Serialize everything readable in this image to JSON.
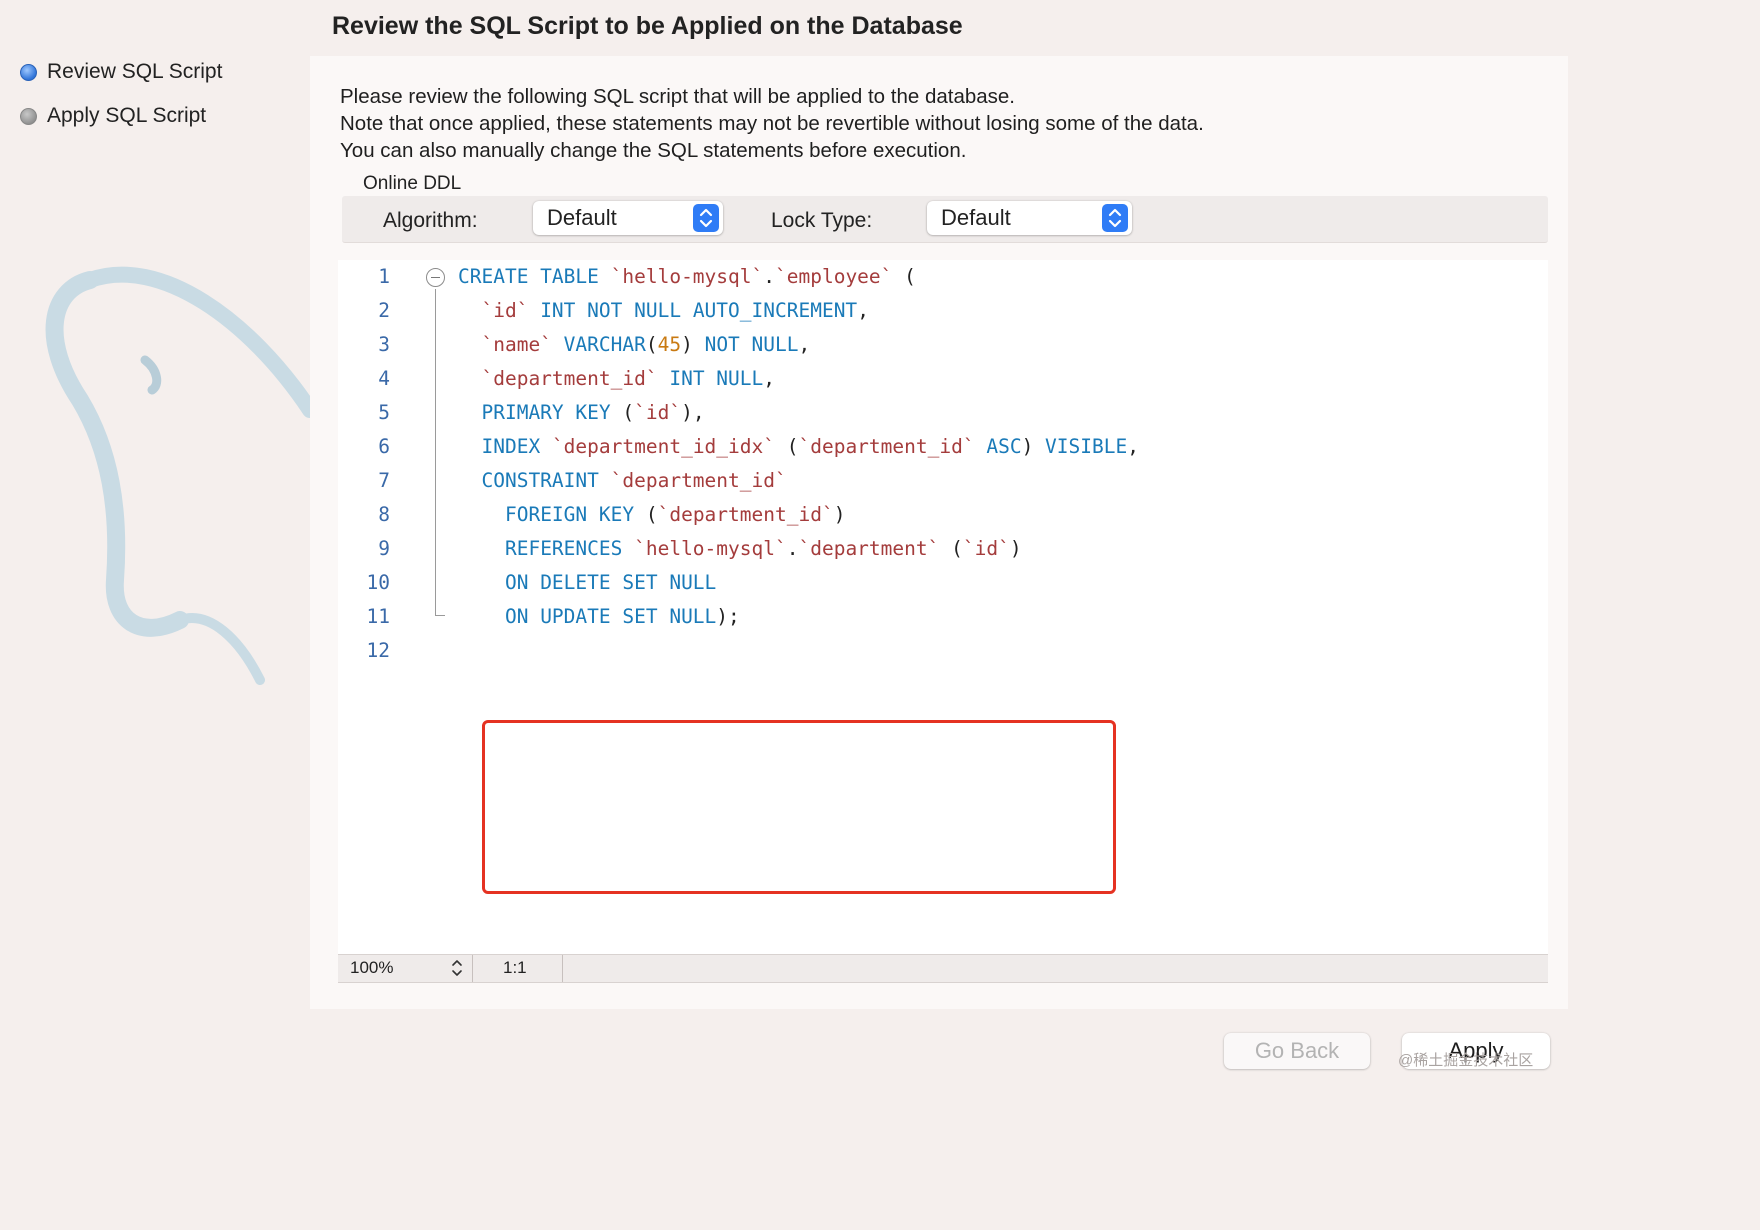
{
  "window": {
    "title": "Review the SQL Script to be Applied on the Database"
  },
  "steps": [
    {
      "label": "Review SQL Script",
      "state": "active"
    },
    {
      "label": "Apply SQL Script",
      "state": "pending"
    }
  ],
  "description": [
    "Please review the following SQL script that will be applied to the database.",
    "Note that once applied, these statements may not be revertible without losing some of the data.",
    "You can also manually change the SQL statements before execution."
  ],
  "online_ddl": {
    "label": "Online DDL",
    "algorithm_label": "Algorithm:",
    "algorithm_value": "Default",
    "lock_type_label": "Lock Type:",
    "lock_type_value": "Default"
  },
  "editor": {
    "lines": [
      [
        [
          "kw",
          "CREATE TABLE "
        ],
        [
          "str",
          "`hello-mysql`"
        ],
        [
          "plain",
          "."
        ],
        [
          "str",
          "`employee`"
        ],
        [
          "plain",
          " ("
        ]
      ],
      [
        [
          "plain",
          "  "
        ],
        [
          "str",
          "`id`"
        ],
        [
          "kw",
          " INT NOT NULL AUTO_INCREMENT"
        ],
        [
          "plain",
          ","
        ]
      ],
      [
        [
          "plain",
          "  "
        ],
        [
          "str",
          "`name`"
        ],
        [
          "kw",
          " VARCHAR"
        ],
        [
          "plain",
          "("
        ],
        [
          "num",
          "45"
        ],
        [
          "plain",
          ") "
        ],
        [
          "kw",
          "NOT NULL"
        ],
        [
          "plain",
          ","
        ]
      ],
      [
        [
          "plain",
          "  "
        ],
        [
          "str",
          "`department_id`"
        ],
        [
          "kw",
          " INT NULL"
        ],
        [
          "plain",
          ","
        ]
      ],
      [
        [
          "plain",
          "  "
        ],
        [
          "kw",
          "PRIMARY KEY"
        ],
        [
          "plain",
          " ("
        ],
        [
          "str",
          "`id`"
        ],
        [
          "plain",
          "),"
        ]
      ],
      [
        [
          "plain",
          "  "
        ],
        [
          "kw",
          "INDEX "
        ],
        [
          "str",
          "`department_id_idx`"
        ],
        [
          "plain",
          " ("
        ],
        [
          "str",
          "`department_id`"
        ],
        [
          "kw",
          " ASC"
        ],
        [
          "plain",
          ") "
        ],
        [
          "kw",
          "VISIBLE"
        ],
        [
          "plain",
          ","
        ]
      ],
      [
        [
          "plain",
          "  "
        ],
        [
          "kw",
          "CONSTRAINT "
        ],
        [
          "str",
          "`department_id`"
        ]
      ],
      [
        [
          "plain",
          "    "
        ],
        [
          "kw",
          "FOREIGN KEY"
        ],
        [
          "plain",
          " ("
        ],
        [
          "str",
          "`department_id`"
        ],
        [
          "plain",
          ")"
        ]
      ],
      [
        [
          "plain",
          "    "
        ],
        [
          "kw",
          "REFERENCES "
        ],
        [
          "str",
          "`hello-mysql`"
        ],
        [
          "plain",
          "."
        ],
        [
          "str",
          "`department`"
        ],
        [
          "plain",
          " ("
        ],
        [
          "str",
          "`id`"
        ],
        [
          "plain",
          ")"
        ]
      ],
      [
        [
          "plain",
          "    "
        ],
        [
          "kw",
          "ON DELETE SET NULL"
        ]
      ],
      [
        [
          "plain",
          "    "
        ],
        [
          "kw",
          "ON UPDATE SET NULL"
        ],
        [
          "plain",
          ");"
        ]
      ],
      []
    ]
  },
  "status_bar": {
    "zoom": "100%",
    "cursor": "1:1"
  },
  "buttons": {
    "go_back": "Go Back",
    "apply": "Apply"
  },
  "watermark": "@稀土掘金技术社区",
  "colors": {
    "keyword": "#1a7ab8",
    "string": "#a43c3c",
    "number": "#c97a12",
    "highlight_border": "#e53222",
    "accent": "#2f7cf6"
  }
}
